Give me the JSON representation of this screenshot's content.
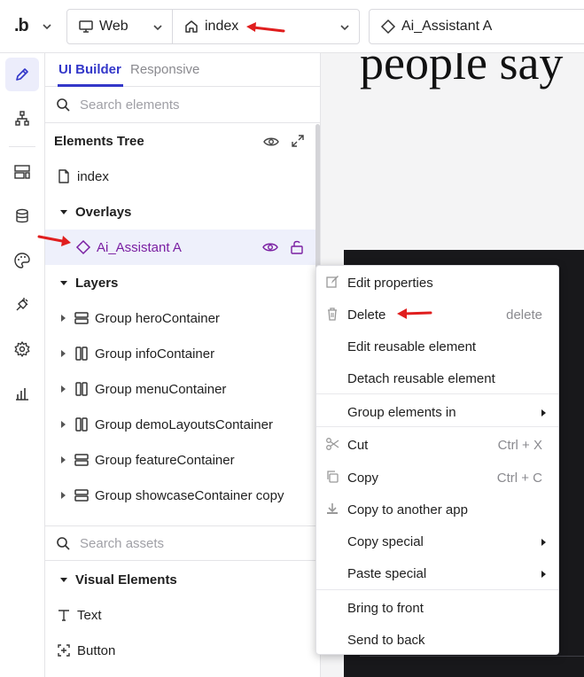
{
  "topbar": {
    "logo": ".b",
    "platform": {
      "label": "Web",
      "icon": "monitor-icon"
    },
    "page": {
      "label": "index",
      "icon": "home-icon"
    },
    "element": {
      "label": "Ai_Assistant A",
      "icon": "diamond-icon"
    }
  },
  "rail": {
    "items": [
      {
        "name": "design",
        "icon": "pencil-icon",
        "active": true
      },
      {
        "name": "workflow",
        "icon": "workflow-icon"
      },
      {
        "name": "layout",
        "icon": "layout-icon"
      },
      {
        "name": "data",
        "icon": "database-icon"
      },
      {
        "name": "styles",
        "icon": "palette-icon"
      },
      {
        "name": "plugins",
        "icon": "plug-icon"
      },
      {
        "name": "settings",
        "icon": "gear-icon"
      },
      {
        "name": "logs",
        "icon": "bar-chart-icon"
      }
    ]
  },
  "panel": {
    "tabs": [
      "UI Builder",
      "Responsive"
    ],
    "search_placeholder": "Search elements",
    "tree_title": "Elements Tree",
    "page_row": "index",
    "overlays_label": "Overlays",
    "selected_overlay": "Ai_Assistant A",
    "layers_label": "Layers",
    "layers": [
      {
        "label": "Group heroContainer",
        "icon": "rows-icon"
      },
      {
        "label": "Group infoContainer",
        "icon": "columns-icon"
      },
      {
        "label": "Group menuContainer",
        "icon": "columns-icon"
      },
      {
        "label": "Group demoLayoutsContainer",
        "icon": "columns-icon"
      },
      {
        "label": "Group featureContainer",
        "icon": "rows-icon"
      },
      {
        "label": "Group showcaseContainer copy",
        "icon": "rows-icon"
      }
    ],
    "assets_placeholder": "Search assets",
    "visual_elements_label": "Visual Elements",
    "visual_elements": [
      {
        "label": "Text",
        "icon": "text-icon"
      },
      {
        "label": "Button",
        "icon": "button-icon"
      }
    ]
  },
  "canvas": {
    "text": "people say"
  },
  "context_menu": {
    "items": [
      {
        "label": "Edit properties",
        "icon": "edit-icon",
        "shortcut": ""
      },
      {
        "label": "Delete",
        "icon": "trash-icon",
        "shortcut": "delete"
      },
      {
        "label": "Edit reusable element",
        "icon": "",
        "shortcut": ""
      },
      {
        "label": "Detach reusable element",
        "icon": "",
        "shortcut": ""
      },
      {
        "label": "Group elements in",
        "icon": "",
        "shortcut": "",
        "submenu": true
      },
      {
        "label": "Cut",
        "icon": "scissors-icon",
        "shortcut": "Ctrl + X"
      },
      {
        "label": "Copy",
        "icon": "copy-icon",
        "shortcut": "Ctrl + C"
      },
      {
        "label": "Copy to another app",
        "icon": "download-icon",
        "shortcut": ""
      },
      {
        "label": "Copy special",
        "icon": "",
        "shortcut": "",
        "submenu": true
      },
      {
        "label": "Paste special",
        "icon": "",
        "shortcut": "",
        "submenu": true
      },
      {
        "label": "Bring to front",
        "icon": "",
        "shortcut": ""
      },
      {
        "label": "Send to back",
        "icon": "",
        "shortcut": ""
      }
    ]
  },
  "colors": {
    "accent": "#3337c9",
    "selected_text": "#7a1fa2",
    "annotation": "#e01e1e"
  }
}
